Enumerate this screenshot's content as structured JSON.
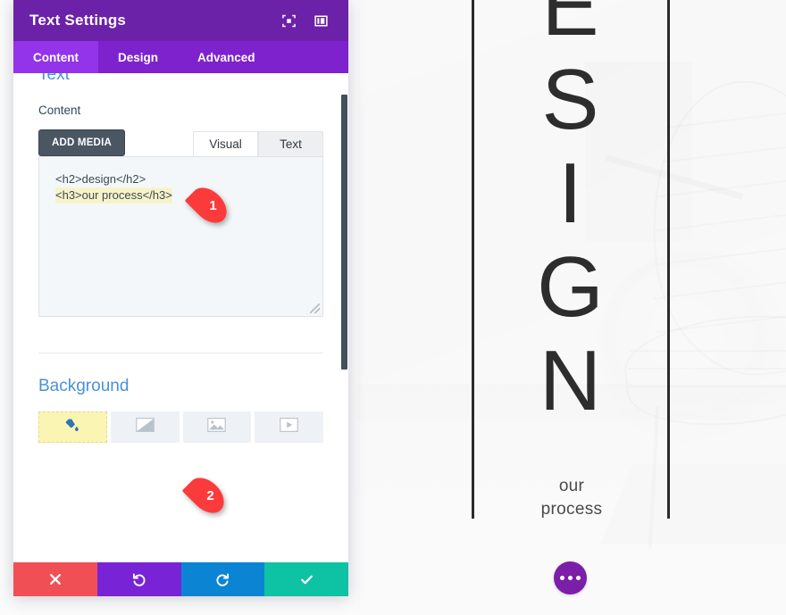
{
  "preview": {
    "headline_letters": [
      "E",
      "S",
      "I",
      "G",
      "N"
    ],
    "subhead_lines": [
      "our",
      "process"
    ],
    "more_button_icon": "ellipsis-icon",
    "background_photo_alt": "wire chair with fur throw"
  },
  "modal": {
    "title": "Text Settings",
    "header_icons": [
      {
        "name": "focus-target-icon"
      },
      {
        "name": "layout-panel-icon"
      }
    ],
    "tabs": [
      {
        "label": "Content",
        "active": true
      },
      {
        "label": "Design",
        "active": false
      },
      {
        "label": "Advanced",
        "active": false
      }
    ],
    "text_section": {
      "title": "Text",
      "content_label": "Content",
      "add_media_label": "ADD MEDIA",
      "editor_tabs": [
        {
          "label": "Visual",
          "active": true
        },
        {
          "label": "Text",
          "active": false
        }
      ],
      "editor_lines": [
        {
          "text": "<h2>design</h2>",
          "highlighted": false
        },
        {
          "text": "<h3>our process</h3>",
          "highlighted": true
        }
      ]
    },
    "background_section": {
      "title": "Background",
      "type_tabs": [
        {
          "name": "background-color-icon",
          "active": true
        },
        {
          "name": "background-gradient-icon",
          "active": false
        },
        {
          "name": "background-image-icon",
          "active": false
        },
        {
          "name": "background-video-icon",
          "active": false
        }
      ]
    },
    "footer_buttons": [
      {
        "name": "cancel-button",
        "icon": "close-icon",
        "color": "#f05055"
      },
      {
        "name": "undo-button",
        "icon": "undo-icon",
        "color": "#7823d6"
      },
      {
        "name": "redo-button",
        "icon": "redo-icon",
        "color": "#0b84d4"
      },
      {
        "name": "save-button",
        "icon": "check-icon",
        "color": "#0ec2a4"
      }
    ]
  },
  "markers": [
    {
      "number": "1"
    },
    {
      "number": "2"
    }
  ],
  "colors": {
    "header_purple": "#6b21a8",
    "tabbar_purple": "#7e22ce",
    "active_tab_purple": "#9333ea",
    "section_title_blue": "#4a90d9",
    "highlight_yellow": "#f7f3c9",
    "marker_red": "#fb3b3b"
  }
}
